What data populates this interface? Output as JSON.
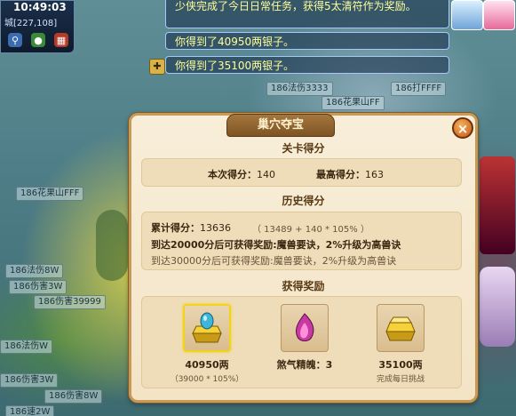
{
  "hud": {
    "clock": "10:49:03",
    "coords_prefix": "城",
    "coords": "[227,108]"
  },
  "chat": {
    "task_line": "少侠完成了今日日常任务，获得5太清符作为奖励。",
    "silver_line_1": "你得到了40950两银子。",
    "silver_line_2": "你得到了35100两银子。"
  },
  "world_tags": [
    "186法伤3333",
    "186打FFFF",
    "186花果山FF",
    "186花果山FFF",
    "186法伤8W",
    "186伤害3W",
    "186伤害39999",
    "186伤害3W",
    "186法伤W",
    "186速2W",
    "186伤害8W"
  ],
  "dialog": {
    "title": "巢穴夺宝",
    "level_score": {
      "heading": "关卡得分",
      "current_label": "本次得分：",
      "current_value": "140",
      "best_label": "最高得分：",
      "best_value": "163"
    },
    "history": {
      "heading": "历史得分",
      "total_label": "累计得分：",
      "total_value": "13636",
      "formula": "（ 13489 + 140 * 105% ）",
      "milestone_1": "到达20000分后可获得奖励:魔兽要诀，2%升级为高兽诀",
      "milestone_2": "到达30000分后可获得奖励:魔兽要诀，2%升级为高兽诀"
    },
    "rewards": {
      "heading": "获得奖励",
      "items": [
        {
          "icon": "gold-ingot-gem-icon",
          "label": "40950两",
          "sub": "（39000 * 105%）"
        },
        {
          "icon": "soul-essence-icon",
          "label": "煞气精魄：3",
          "sub": ""
        },
        {
          "icon": "gold-ingot-icon",
          "label": "35100两",
          "sub": "完成每日挑战"
        }
      ]
    }
  },
  "colors": {
    "dialog_bg": "#f8eed9",
    "dialog_border": "#c79a57",
    "chat_text": "#ffff9a",
    "selected_border": "#f2d21b"
  }
}
